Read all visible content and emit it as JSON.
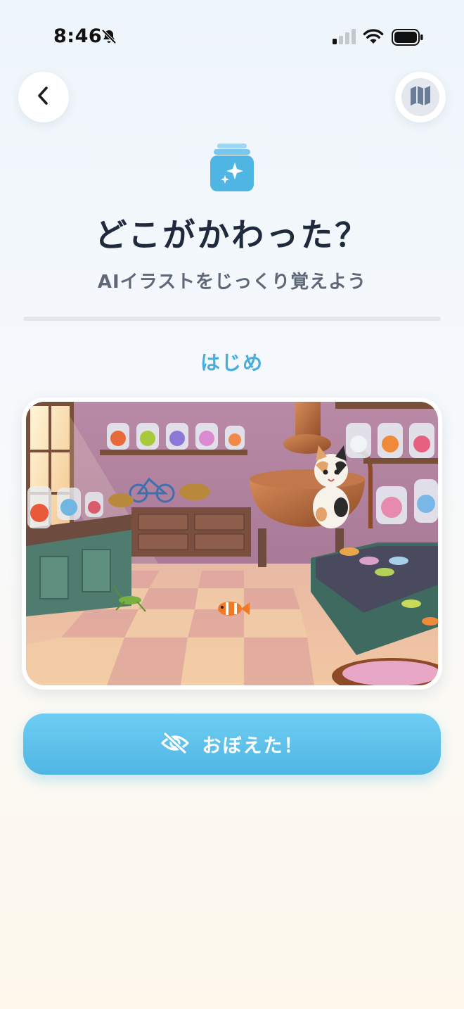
{
  "status_bar": {
    "time": "8:46",
    "icons": [
      "bell-slash-icon",
      "cellular-signal-icon",
      "wifi-icon",
      "battery-icon"
    ]
  },
  "nav": {
    "back_icon": "chevron-left-icon",
    "map_icon": "map-icon"
  },
  "header": {
    "icon": "sparkles-stack-icon",
    "title": "どこがかわった？",
    "subtitle": "AIイラストをじっくり覚えよう"
  },
  "progress": {
    "fraction": 0
  },
  "phase": {
    "label": "はじめ"
  },
  "illustration": {
    "description_icon": "candy-shop-scene-image"
  },
  "action": {
    "label": "おぼえた！",
    "icon": "eye-slash-icon"
  },
  "colors": {
    "accent": "#4aaedc",
    "title": "#1f2a3c",
    "subtitle": "#5f6878",
    "button": "#5bbfe9"
  }
}
